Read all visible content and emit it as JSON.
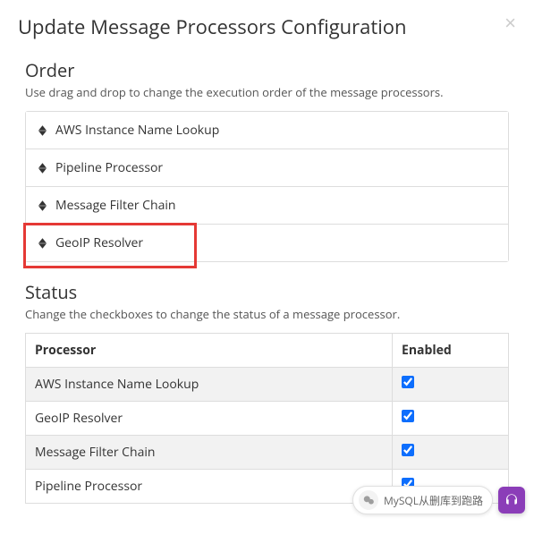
{
  "modal": {
    "title": "Update Message Processors Configuration",
    "close_label": "×"
  },
  "order": {
    "title": "Order",
    "description": "Use drag and drop to change the execution order of the message processors.",
    "items": [
      {
        "label": "AWS Instance Name Lookup",
        "highlighted": false
      },
      {
        "label": "Pipeline Processor",
        "highlighted": false
      },
      {
        "label": "Message Filter Chain",
        "highlighted": false
      },
      {
        "label": "GeoIP Resolver",
        "highlighted": true
      }
    ]
  },
  "status": {
    "title": "Status",
    "description": "Change the checkboxes to change the status of a message processor.",
    "columns": {
      "processor": "Processor",
      "enabled": "Enabled"
    },
    "rows": [
      {
        "processor": "AWS Instance Name Lookup",
        "enabled": true
      },
      {
        "processor": "GeoIP Resolver",
        "enabled": true
      },
      {
        "processor": "Message Filter Chain",
        "enabled": true
      },
      {
        "processor": "Pipeline Processor",
        "enabled": true
      }
    ]
  },
  "footer": {
    "wechat_label": "MySQL从删库到跑路"
  }
}
